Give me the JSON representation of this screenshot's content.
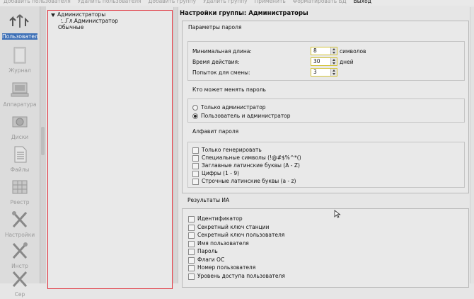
{
  "menu": [
    "Добавить пользователя",
    "Удалить пользователя",
    "Добавить группу",
    "Удалить группу",
    "Применить",
    "Форматировать БД",
    "Выход"
  ],
  "nav": [
    {
      "label": "Пользовател",
      "icon": "users-icon"
    },
    {
      "label": "Журнал",
      "icon": "journal-icon"
    },
    {
      "label": "Аппаратура",
      "icon": "hardware-icon"
    },
    {
      "label": "Диски",
      "icon": "disks-icon"
    },
    {
      "label": "Файлы",
      "icon": "files-icon"
    },
    {
      "label": "Реестр",
      "icon": "registry-icon"
    },
    {
      "label": "Настройки",
      "icon": "tools-icon"
    },
    {
      "label": "Инстр",
      "icon": "tools-icon"
    },
    {
      "label": "Сер",
      "icon": "tools-icon"
    }
  ],
  "tree": {
    "root": "Администраторы",
    "child": "Гл.Администратор",
    "sibling": "Обычные"
  },
  "settings_title": "Настройки группы: Администраторы",
  "password": {
    "title": "Параметры пароля",
    "min_length_label": "Минимальная длина:",
    "min_length_value": "8",
    "min_length_unit": "символов",
    "validity_label": "Время действия:",
    "validity_value": "30",
    "validity_unit": "дней",
    "attempts_label": "Попыток для смены:",
    "attempts_value": "3"
  },
  "who_can_change": {
    "title": "Кто может менять пароль",
    "options": [
      "Только администратор",
      "Пользователь и администратор"
    ],
    "selected": 1
  },
  "alphabet": {
    "title": "Алфавит пароля",
    "options": [
      "Только генерировать",
      "Специальные символы (!@#$%^*()",
      "Заглавные латинские буквы (A - Z)",
      "Цифры (1 - 9)",
      "Строчные латинские буквы (a - z)"
    ]
  },
  "results": {
    "title": "Результаты ИА",
    "options": [
      "Идентификатор",
      "Секретный ключ станции",
      "Секретный ключ пользователя",
      "Имя пользователя",
      "Пароль",
      "Флаги ОС",
      "Номер пользователя",
      "Уровень доступа пользователя"
    ]
  },
  "colors": {
    "selection": "#3c6fb6",
    "tree_border": "#e0303a",
    "spin_border": "#d4c43a"
  }
}
